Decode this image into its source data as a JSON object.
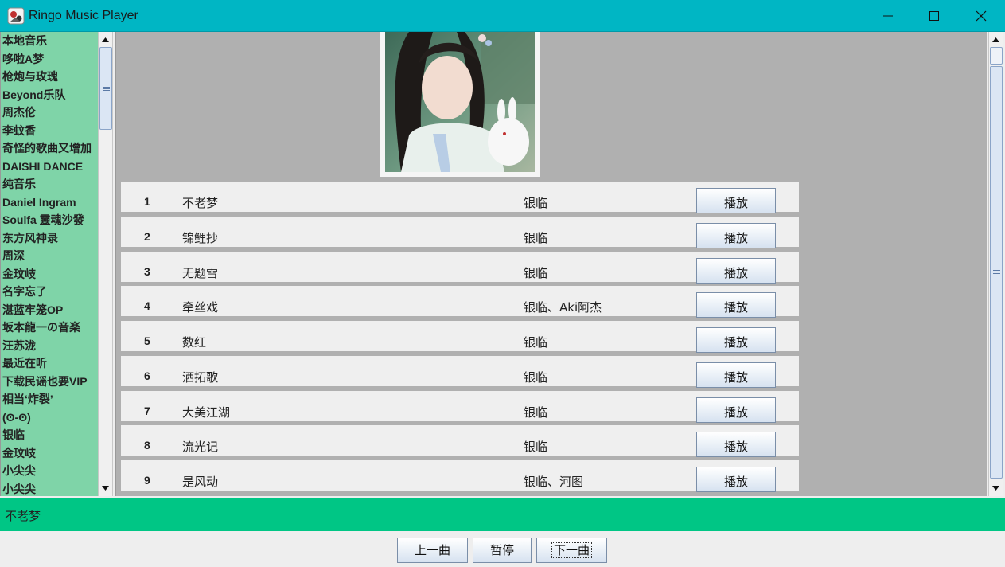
{
  "window": {
    "title": "Ringo Music Player",
    "accent_color": "#00b6c4",
    "controls": [
      "minimize-icon",
      "maximize-icon",
      "close-icon"
    ]
  },
  "sidebar": {
    "background": "#7fd4a8",
    "items": [
      {
        "label": "本地音乐"
      },
      {
        "label": "哆啦A梦"
      },
      {
        "label": "枪炮与玫瑰"
      },
      {
        "label": "Beyond乐队"
      },
      {
        "label": "周杰伦"
      },
      {
        "label": "李蚊香"
      },
      {
        "label": "奇怪的歌曲又增加"
      },
      {
        "label": "DAISHI DANCE"
      },
      {
        "label": "纯音乐"
      },
      {
        "label": "Daniel Ingram"
      },
      {
        "label": "Soulfa 靈魂沙發"
      },
      {
        "label": "东方风神录"
      },
      {
        "label": "周深"
      },
      {
        "label": "金玟岐"
      },
      {
        "label": "名字忘了"
      },
      {
        "label": "湛蓝牢笼OP"
      },
      {
        "label": "坂本龍一の音楽"
      },
      {
        "label": "汪苏泷"
      },
      {
        "label": "最近在听"
      },
      {
        "label": "下载民谣也要VIP"
      },
      {
        "label": "相当‘炸裂’"
      },
      {
        "label": "(ʘ-ʘ)"
      },
      {
        "label": "银临"
      },
      {
        "label": "金玟岐"
      },
      {
        "label": "小尖尖"
      },
      {
        "label": "小尖尖"
      }
    ]
  },
  "album_art": {
    "description_icon": "album-cover-image",
    "palette": {
      "dark": "#4a7e6c",
      "light": "#e8f0ec",
      "blue": "#abc4e4",
      "pink": "#f0dada"
    }
  },
  "songs": [
    {
      "num": "1",
      "title": "不老梦",
      "artist": "银临",
      "action": "播放"
    },
    {
      "num": "2",
      "title": "锦鲤抄",
      "artist": "银临",
      "action": "播放"
    },
    {
      "num": "3",
      "title": "无题雪",
      "artist": "银临",
      "action": "播放"
    },
    {
      "num": "4",
      "title": "牵丝戏",
      "artist": "银临、Aki阿杰",
      "action": "播放"
    },
    {
      "num": "5",
      "title": "数红",
      "artist": "银临",
      "action": "播放"
    },
    {
      "num": "6",
      "title": "洒拓歌",
      "artist": "银临",
      "action": "播放"
    },
    {
      "num": "7",
      "title": "大美江湖",
      "artist": "银临",
      "action": "播放"
    },
    {
      "num": "8",
      "title": "流光记",
      "artist": "银临",
      "action": "播放"
    },
    {
      "num": "9",
      "title": "是风动",
      "artist": "银临、河图",
      "action": "播放"
    }
  ],
  "now_playing": {
    "title": "不老梦",
    "background": "#00c685"
  },
  "controls": {
    "prev_label": "上一曲",
    "pause_label": "暂停",
    "next_label": "下一曲"
  }
}
